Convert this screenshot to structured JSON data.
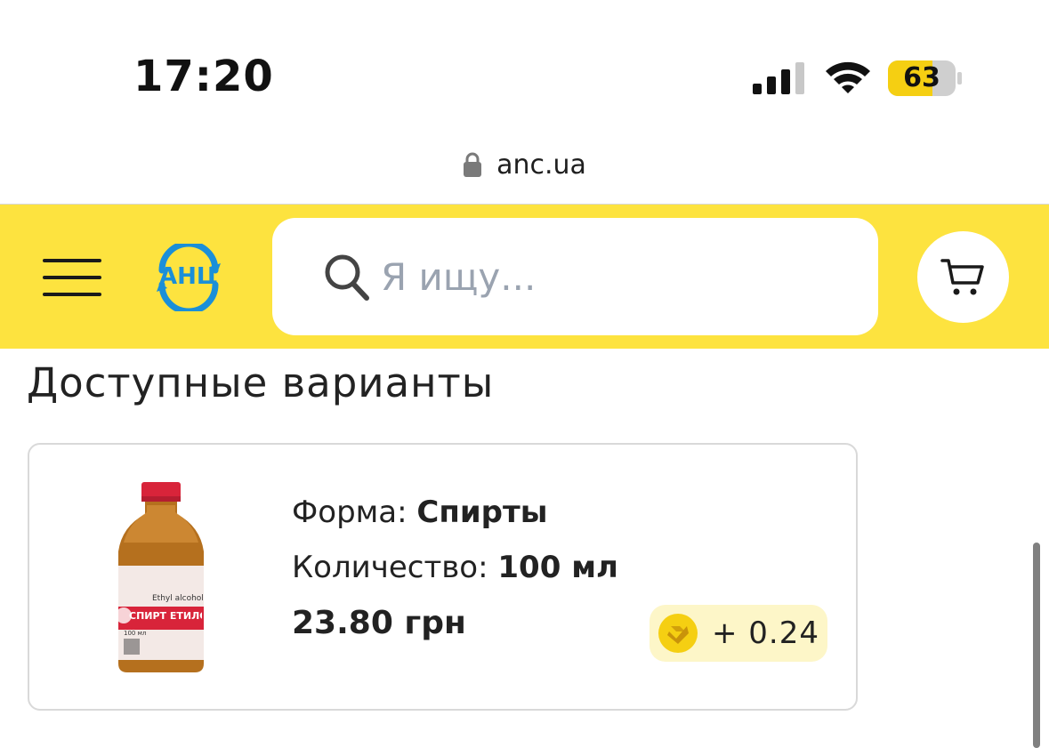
{
  "status_bar": {
    "time": "17:20",
    "battery": "63"
  },
  "browser": {
    "url": "anc.ua"
  },
  "header": {
    "logo_text": "АНЦ",
    "search_placeholder": "Я ищу...",
    "brand_color": "#fde33f",
    "logo_color": "#1a8fd8"
  },
  "section": {
    "title": "Доступные варианты"
  },
  "variant": {
    "form_label": "Форма:",
    "form_value": "Спирты",
    "qty_label": "Количество:",
    "qty_value": "100 мл",
    "price": "23.80 грн",
    "bonus": "+ 0.24",
    "image_label_top": "Ethyl alcohol",
    "image_label_main": "СПИРТ ЕТИЛОВИЙ",
    "image_volume": "100 мл"
  },
  "icons": {
    "signal": "cellular-signal-icon",
    "wifi": "wifi-icon",
    "battery": "battery-icon",
    "lock": "lock-icon",
    "menu": "hamburger-menu-icon",
    "search": "search-icon",
    "cart": "cart-icon",
    "bonus": "bonus-coin-icon"
  }
}
